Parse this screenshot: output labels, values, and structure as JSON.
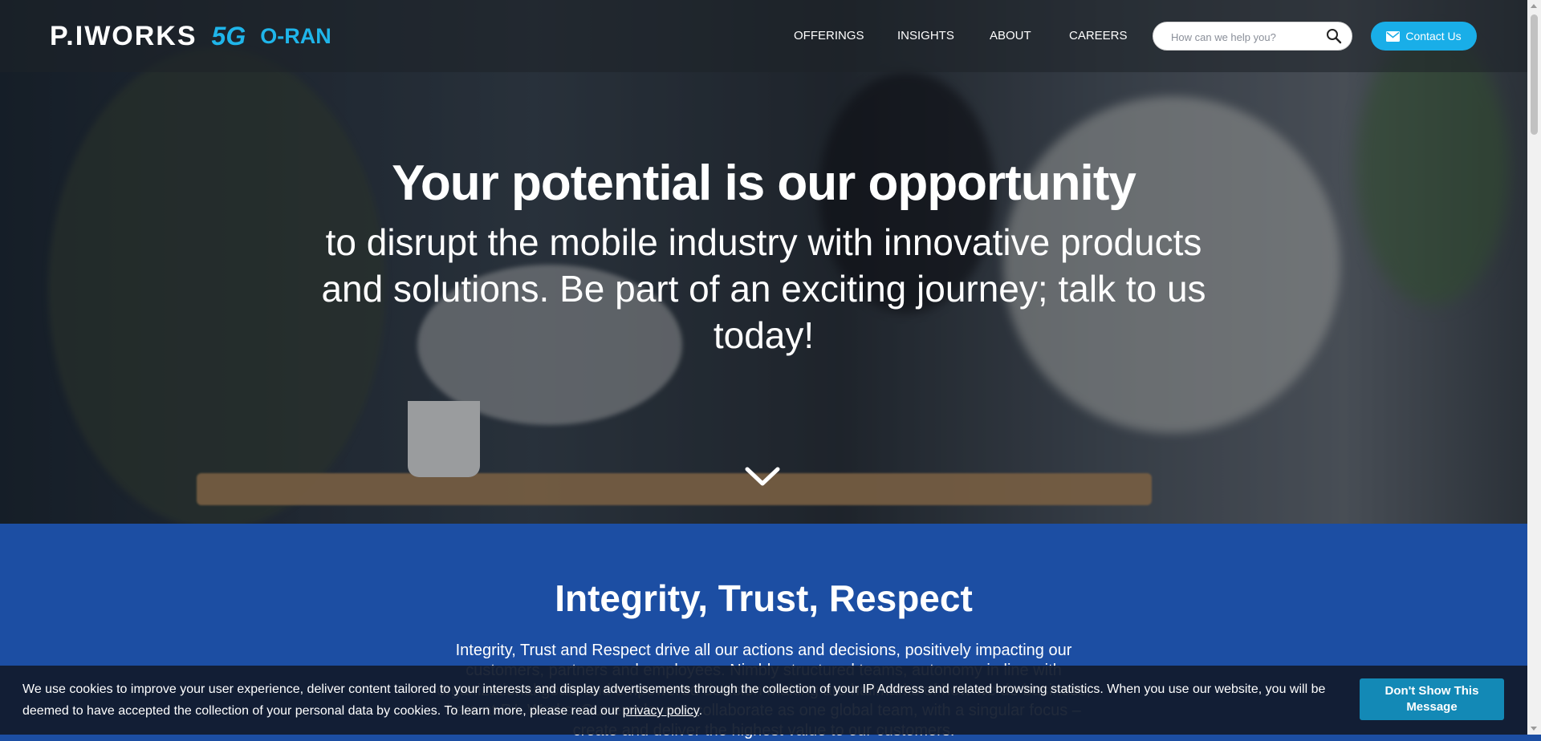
{
  "header": {
    "logo": {
      "brand": "P.IWORKS",
      "badge_5g": "5G",
      "badge_oran": "O-RAN"
    },
    "nav": [
      {
        "label": "OFFERINGS"
      },
      {
        "label": "INSIGHTS"
      },
      {
        "label": "ABOUT"
      },
      {
        "label": "CAREERS"
      }
    ],
    "search": {
      "placeholder": "How can we help you?",
      "value": ""
    },
    "contact_label": "Contact Us"
  },
  "hero": {
    "title": "Your potential is our opportunity",
    "subtitle": "to disrupt the mobile industry with innovative products and solutions. Be part of an exciting journey; talk to us today!"
  },
  "values": {
    "heading": "Integrity, Trust, Respect",
    "body": "Integrity, Trust and Respect drive all our actions and decisions, positively impacting our customers, partners and employees. Nimbly structured teams, autonomy in line with organizational goals and empowered decision making are hallmarks of how we do business, here at P.I. Works. Our employees collaborate as one global team, with a singular focus – create and deliver the highest value to our customers."
  },
  "cookie": {
    "text_before": "We use cookies to improve your user experience, deliver content tailored to your interests and display advertisements through the collection of your IP Address and related browsing statistics. When you use our website, you will be deemed to have accepted the collection of your personal data by cookies. To learn more, please read our ",
    "link": "privacy policy",
    "text_after": ".",
    "button": "Don't Show This Message"
  },
  "colors": {
    "accent": "#19aee8",
    "section_blue": "#1c4ea3",
    "cookie_button": "#1389b6"
  },
  "icons": {
    "search": "search-icon",
    "mail": "mail-icon",
    "scroll_down": "chevron-down-icon"
  }
}
